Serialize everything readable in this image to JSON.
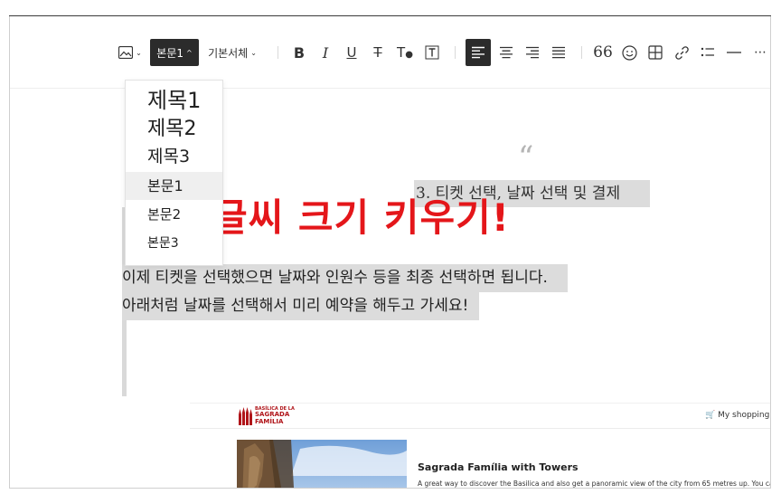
{
  "toolbar": {
    "text_style_label": "본문1",
    "font_family_label": "기본서체",
    "image_icon": "image-icon",
    "bold_icon": "bold-icon",
    "italic_icon": "italic-icon",
    "underline_icon": "underline-icon",
    "strikethrough_icon": "strikethrough-icon",
    "text_color_icon": "text-color-icon",
    "text_background_icon": "text-background-icon",
    "align_left_icon": "align-left-icon",
    "align_center_icon": "align-center-icon",
    "align_right_icon": "align-right-icon",
    "align_justify_icon": "align-justify-icon",
    "quote_icon": "quote-icon",
    "emoji_icon": "emoji-icon",
    "table_icon": "table-icon",
    "link_icon": "link-icon",
    "list_icon": "list-icon",
    "divider_icon": "divider-icon",
    "more_icon": "more-icon"
  },
  "dropdown": {
    "items": [
      {
        "label": "제목1",
        "selected": false
      },
      {
        "label": "제목2",
        "selected": false
      },
      {
        "label": "제목3",
        "selected": false
      },
      {
        "label": "본문1",
        "selected": true
      },
      {
        "label": "본문2",
        "selected": false
      },
      {
        "label": "본문3",
        "selected": false
      }
    ]
  },
  "editor": {
    "quote_heading": "3. 티켓 선택, 날짜 선택 및 결제",
    "overlay_text": "글씨 크기 키우기!",
    "overlay_color": "#e4161a",
    "paragraph_1": "이제 티켓을 선택했으면 날짜와 인원수 등을 최종 선택하면 됩니다.",
    "paragraph_2": "아래처럼 날짜를 선택해서 미리 예약을 해두고 가세요!"
  },
  "embedded_site": {
    "logo_line_1": "BASÍLICA DE LA",
    "logo_line_2": "SAGRADA",
    "logo_line_3": "FAMÍLIA",
    "cart_label": "My shopping c",
    "card_title": "Sagrada Família with Towers",
    "card_description": "A great way to discover the Basilica and also get a panoramic view of the city from 65 metres up. You can cho",
    "brand_color": "#b01419"
  }
}
